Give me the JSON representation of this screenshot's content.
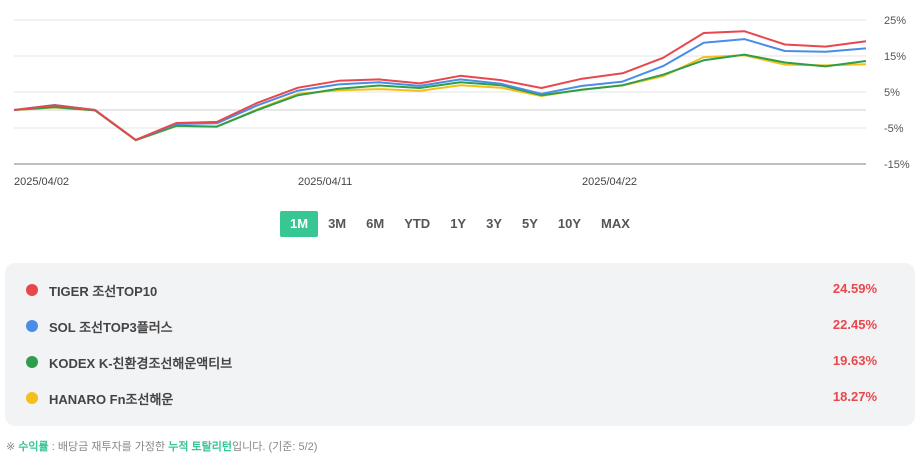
{
  "chart_data": {
    "type": "line",
    "x": [
      "2025/04/02",
      "2025/04/03",
      "2025/04/04",
      "2025/04/07",
      "2025/04/08",
      "2025/04/09",
      "2025/04/10",
      "2025/04/11",
      "2025/04/14",
      "2025/04/15",
      "2025/04/16",
      "2025/04/17",
      "2025/04/18",
      "2025/04/21",
      "2025/04/22",
      "2025/04/23",
      "2025/04/24",
      "2025/04/25",
      "2025/04/28",
      "2025/04/29",
      "2025/04/30",
      "2025/05/02"
    ],
    "x_tick_labels": [
      "2025/04/02",
      "2025/04/11",
      "2025/04/22"
    ],
    "y_tick_labels": [
      "25%",
      "15%",
      "5%",
      "-5%",
      "-15%"
    ],
    "ylim": [
      -15,
      25
    ],
    "series": [
      {
        "name": "TIGER 조선TOP10",
        "color": "#e8474c",
        "values": [
          0,
          1.3,
          0,
          -8.3,
          -3.6,
          -3.3,
          2,
          6.2,
          8.1,
          8.5,
          7.4,
          9.5,
          8.3,
          6.1,
          8.7,
          10.2,
          14.5,
          21.4,
          21.9,
          18.2,
          17.6,
          19.1
        ]
      },
      {
        "name": "SOL 조선TOP3플러스",
        "color": "#4a8de8",
        "values": [
          0,
          1.4,
          0,
          -8.3,
          -3.9,
          -3.7,
          1.3,
          5.4,
          7.1,
          7.7,
          6.7,
          8.5,
          7.3,
          4.5,
          6.7,
          7.9,
          12.2,
          18.7,
          19.7,
          16.4,
          16.2,
          17.1
        ]
      },
      {
        "name": "KODEX K-친환경조선해운액티브",
        "color": "#2e9e4a",
        "values": [
          0,
          0.8,
          -0.1,
          -8.4,
          -4.4,
          -4.6,
          0,
          4.1,
          5.9,
          6.8,
          6.1,
          7.7,
          6.9,
          4.1,
          5.6,
          6.9,
          9.8,
          13.8,
          15.4,
          13.2,
          12.1,
          13.6
        ]
      },
      {
        "name": "HANARO Fn조선해운",
        "color": "#f4c018",
        "values": [
          0,
          0.7,
          -0.1,
          -8.4,
          -4.5,
          -4.6,
          0.2,
          4.5,
          5.5,
          5.8,
          5.3,
          6.9,
          6.2,
          3.9,
          5.7,
          6.8,
          9.4,
          14.7,
          15.2,
          12.6,
          12.4,
          12.7
        ]
      }
    ]
  },
  "range_tabs": {
    "items": [
      {
        "label": "1M"
      },
      {
        "label": "3M"
      },
      {
        "label": "6M"
      },
      {
        "label": "YTD"
      },
      {
        "label": "1Y"
      },
      {
        "label": "3Y"
      },
      {
        "label": "5Y"
      },
      {
        "label": "10Y"
      },
      {
        "label": "MAX"
      }
    ],
    "active": "1M",
    "active_color": "#38c793"
  },
  "legend": {
    "items": [
      {
        "name": "TIGER 조선TOP10",
        "color": "#e8474c",
        "value": "24.59%"
      },
      {
        "name": "SOL 조선TOP3플러스",
        "color": "#4a8de8",
        "value": "22.45%"
      },
      {
        "name": "KODEX K-친환경조선해운액티브",
        "color": "#2e9e4a",
        "value": "19.63%"
      },
      {
        "name": "HANARO Fn조선해운",
        "color": "#f4c018",
        "value": "18.27%"
      }
    ],
    "value_color": "#e8474c"
  },
  "footnote": {
    "prefix": "※ ",
    "highlight1": "수익률",
    "middle": " : 배당금 재투자를 가정한 ",
    "highlight2": "누적 토탈리턴",
    "suffix": "입니다. (기준: 5/2)"
  }
}
